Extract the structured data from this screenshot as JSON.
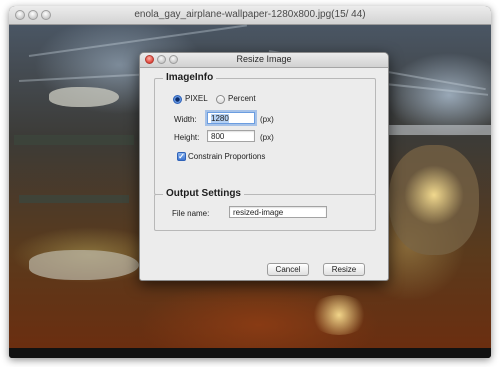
{
  "window": {
    "title": "enola_gay_airplane-wallpaper-1280x800.jpg(15/ 44)"
  },
  "dialog": {
    "title": "Resize Image",
    "image_info": {
      "legend": "ImageInfo",
      "radio_pixel": "PIXEL",
      "radio_percent": "Percent",
      "selected_unit": "PIXEL",
      "width_label": "Width:",
      "width_value": "1280",
      "width_unit": "(px)",
      "height_label": "Height:",
      "height_value": "800",
      "height_unit": "(px)",
      "constrain_label": "Constrain Proportions",
      "constrain_checked": true
    },
    "output": {
      "legend": "Output Settings",
      "file_name_label": "File name:",
      "file_name_value": "resized-image"
    },
    "buttons": {
      "cancel": "Cancel",
      "resize": "Resize"
    }
  },
  "colors": {
    "accent": "#3b74d0",
    "dialog_bg": "#ececec",
    "close_red": "#e0443a"
  },
  "icons": [
    "close-icon",
    "minimize-icon",
    "zoom-icon",
    "checkmark-icon"
  ]
}
